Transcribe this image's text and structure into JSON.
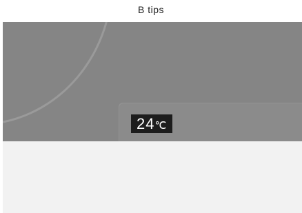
{
  "header": {
    "title": "B tips"
  },
  "display": {
    "temperature_value": "24",
    "temperature_unit": "℃"
  },
  "colors": {
    "photo_background": "#858585",
    "badge_background": "#1d1d1d",
    "badge_text": "#ffffff",
    "bottom_area": "#f2f2f2"
  }
}
